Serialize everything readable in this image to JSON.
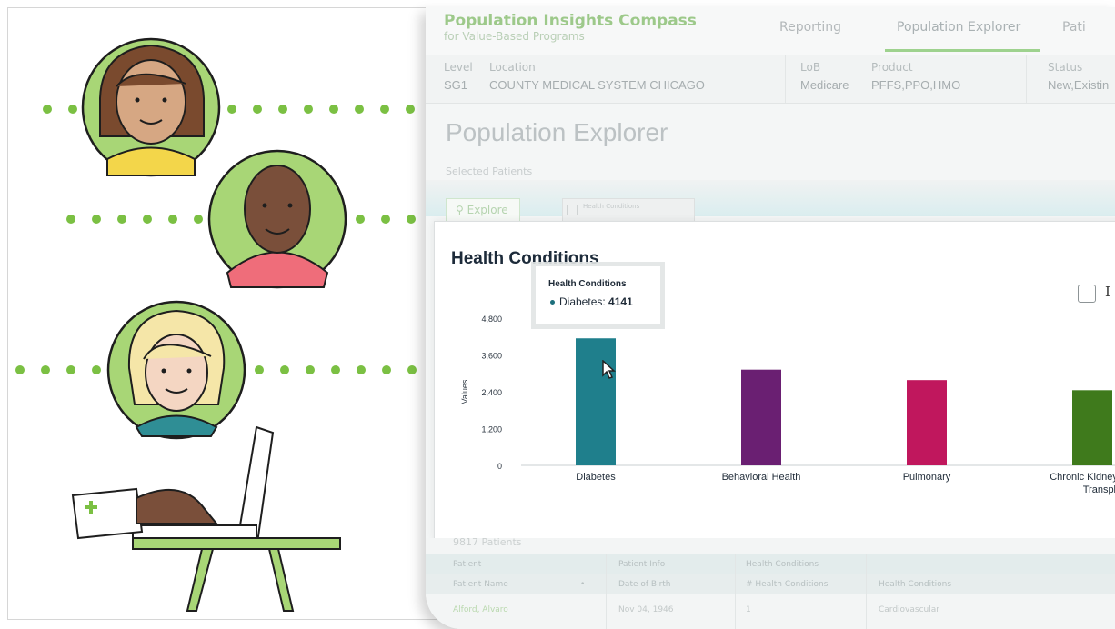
{
  "app": {
    "brand_title": "Population Insights Compass",
    "brand_subtitle": "for Value-Based Programs",
    "nav": [
      "Reporting",
      "Population Explorer",
      "Pati"
    ]
  },
  "filters": {
    "level_label": "Level",
    "level_value": "SG1",
    "location_label": "Location",
    "location_value": "COUNTY MEDICAL SYSTEM CHICAGO",
    "lob_label": "LoB",
    "lob_value": "Medicare",
    "product_label": "Product",
    "product_value": "PFFS,PPO,HMO",
    "status_label": "Status",
    "status_value": "New,Existin"
  },
  "page": {
    "title": "Population Explorer",
    "selected_patients": "Selected Patients",
    "explore_button": "Explore",
    "chip_label": "Health Conditions"
  },
  "card": {
    "title": "Health Conditions",
    "legend_fragment": "I"
  },
  "tooltip": {
    "title": "Health Conditions",
    "label": "Diabetes:",
    "value": "4141"
  },
  "chart_data": {
    "type": "bar",
    "title": "Health Conditions",
    "ylabel": "Values",
    "xlabel": "",
    "ylim": [
      0,
      4800
    ],
    "yticks": [
      "4,800",
      "3,600",
      "2,400",
      "1,200",
      "0"
    ],
    "categories": [
      "Diabetes",
      "Behavioral Health",
      "Pulmonary",
      "Chronic Kidney Dis"
    ],
    "category_line2": [
      "",
      "",
      "",
      "Transplan"
    ],
    "values": [
      4141,
      3120,
      2780,
      2450
    ],
    "colors": [
      "#1f7f8c",
      "#6a1f72",
      "#c0175d",
      "#3f7a1c"
    ]
  },
  "table": {
    "count": "9817 Patients",
    "group_headers": [
      "Patient",
      "Patient Info",
      "Health Conditions"
    ],
    "columns": [
      "Patient Name",
      "Date of Birth",
      "# Health Conditions",
      "Health Conditions"
    ],
    "rows": [
      {
        "name": "Alford, Alvaro",
        "dob": "Nov 04, 1946",
        "count": "1",
        "conditions": "Cardiovascular"
      }
    ]
  }
}
